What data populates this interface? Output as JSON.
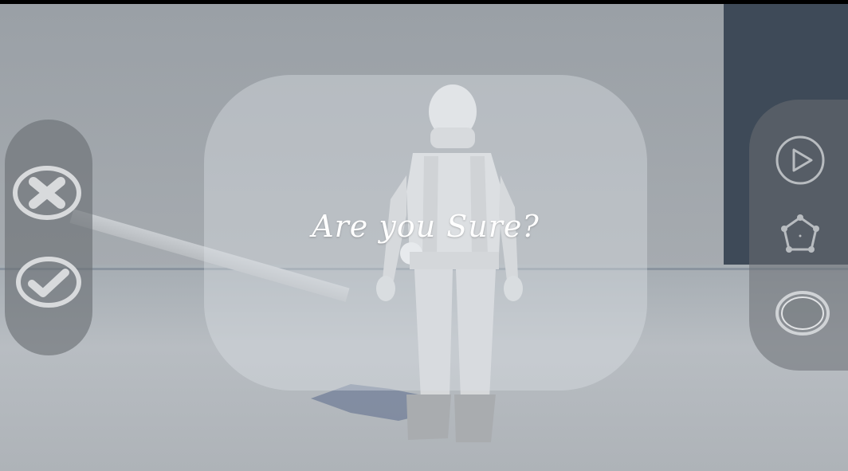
{
  "dialog": {
    "message": "Are you Sure?"
  },
  "left_controls": [
    {
      "icon": "close-icon",
      "role": "cancel"
    },
    {
      "icon": "check-icon",
      "role": "confirm"
    }
  ],
  "right_controls": [
    {
      "icon": "play-icon"
    },
    {
      "icon": "pentagon-icon"
    },
    {
      "icon": "circle-button-icon"
    }
  ],
  "colors": {
    "panel": "#6e7378",
    "icon": "#d8dadc",
    "dialog_text": "#ffffff",
    "dark_wall": "#3e4a58"
  }
}
